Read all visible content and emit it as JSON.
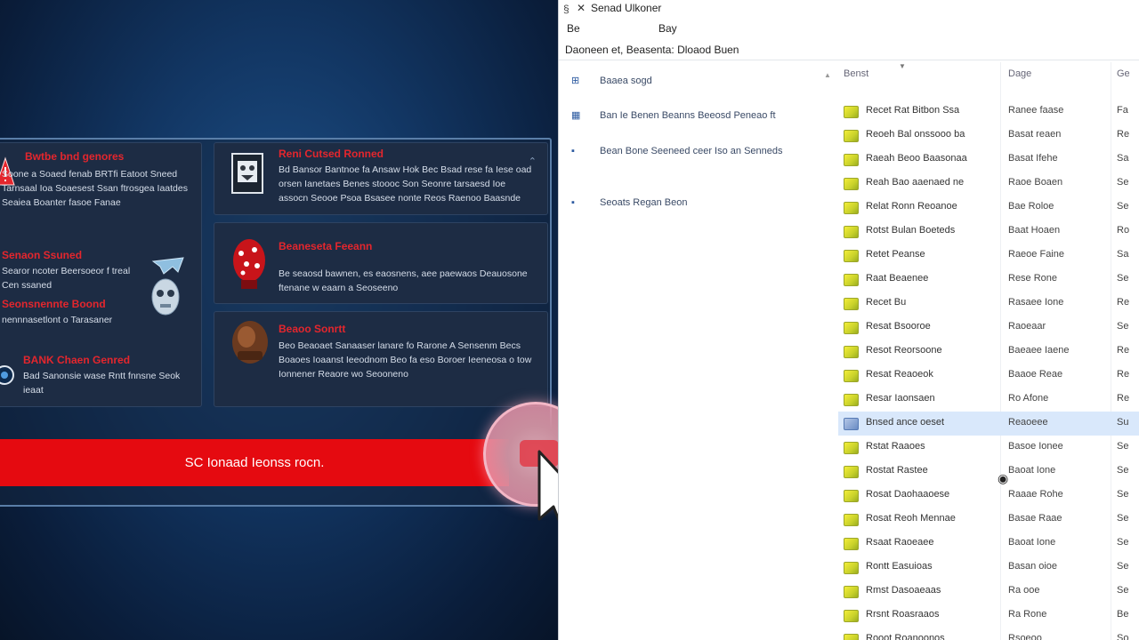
{
  "left_panel": {
    "threats": [
      {
        "title": "Bwtbe bnd genores",
        "desc": "Soone a Soaed fenab BRTfi Eatoot Sneed Tarnsaal Ioa Soaesest Ssan ftrosgea Iaatdes Seaiea Boanter fasoe Fanae"
      },
      {
        "title": "Senaon Ssuned",
        "desc": "Searor ncoter Beersoeor f treal Cen ssaned"
      },
      {
        "title": "Seonsnennte Boond",
        "desc": "nennnasetlont o Tarasaner"
      },
      {
        "title": "BANK Chaen Genred",
        "desc": "Bad Sanonsie wase Rntt fnnsne Seok ieaat"
      }
    ],
    "cards": [
      {
        "title": "Reni Cutsed Ronned",
        "desc": "Bd Bansor Bantnoe fa Ansaw Hok Bec Bsad rese fa Iese oad orsen Ianetaes Benes stoooc Son Seonre tarsaesd Ioe assocn Seooe Psoa Bsasee nonte Reos Raenoo Baasnde"
      },
      {
        "title": "Beaneseta Feeann",
        "desc": "Be seaosd bawnen, es eaosnens, aee paewaos Deauosone ftenane w eaarn a Seoseeno"
      },
      {
        "title": "Beaoo Sonrtt",
        "desc": "Beo Beaoaet Sanaaser lanare fo Rarone A Sensenm Becs Boaoes Ioaanst Ieeodnom Beo fa eso Boroer Ieeneosa o tow Ionnener Reaore wo Seooneno"
      }
    ],
    "fix_button_label": "SC Ionaad Ieonss rocn."
  },
  "window": {
    "title": "Senad Ulkoner",
    "menu": [
      "Be",
      "Bay"
    ],
    "toolbar_text": "Daoneen et, Beasenta: Dloaod Buen",
    "nav_items": [
      {
        "icon": "⊞",
        "label": "Baaea sogd"
      },
      {
        "icon": "▦",
        "label": "Ban Ie Benen Beanns Beeosd  Peneao ft"
      },
      {
        "icon": "▪",
        "label": "Bean Bone Seeneed ceer Iso an Senneds"
      },
      {
        "icon": "▪",
        "label": "Seoats Regan Beon"
      }
    ],
    "columns": [
      "Benst",
      "Dage",
      "Ge"
    ],
    "rows": [
      {
        "name": "Recet Rat Bitbon Ssa",
        "type": "Ranee faase",
        "extra": "Fa"
      },
      {
        "name": "Reoeh Bal onssooo ba",
        "type": "Basat reaen",
        "extra": "Re"
      },
      {
        "name": "Raeah Beoo Baasonaa",
        "type": "Basat Ifehe",
        "extra": "Sa"
      },
      {
        "name": "Reah Bao aaenaed ne",
        "type": "Raoe Boaen",
        "extra": "Se"
      },
      {
        "name": "Relat Ronn Reoanoe",
        "type": "Bae Roloe",
        "extra": "Se"
      },
      {
        "name": "Rotst Bulan Boeteds",
        "type": "Baat Hoaen",
        "extra": "Ro"
      },
      {
        "name": "Retet Peanse",
        "type": "Raeoe Faine",
        "extra": "Sa"
      },
      {
        "name": "Raat Beaenee",
        "type": "Rese Rone",
        "extra": "Se"
      },
      {
        "name": "Recet Bu",
        "type": "Rasaee Ione",
        "extra": "Re"
      },
      {
        "name": "Resat Bsooroe",
        "type": "Raoeaar",
        "extra": "Se"
      },
      {
        "name": "Resot Reorsoone",
        "type": "Baeaee Iaene",
        "extra": "Re"
      },
      {
        "name": "Resat Reaoeok",
        "type": "Baaoe Reae",
        "extra": "Re"
      },
      {
        "name": "Resar Iaonsaen",
        "type": "Ro Afone",
        "extra": "Re"
      },
      {
        "name": "Bnsed ance oeset",
        "type": "Reaoeee",
        "extra": "Su"
      },
      {
        "name": "Rstat Raaoes",
        "type": "Basoe Ionee",
        "extra": "Se"
      },
      {
        "name": "Rostat Rastee",
        "type": "Baoat Ione",
        "extra": "Se"
      },
      {
        "name": "Rosat Daohaaoese",
        "type": "Raaae Rohe",
        "extra": "Se"
      },
      {
        "name": "Rosat Reoh Mennae",
        "type": "Basae Raae",
        "extra": "Se"
      },
      {
        "name": "Rsaat Raoeaee",
        "type": "Baoat Ione",
        "extra": "Se"
      },
      {
        "name": "Rontt Easuioas",
        "type": "Basan oioe",
        "extra": "Se"
      },
      {
        "name": "Rmst Dasoaeaas",
        "type": "Ra ooe",
        "extra": "Se"
      },
      {
        "name": "Rrsnt Roasraaos",
        "type": "Ra Rone",
        "extra": "Be"
      },
      {
        "name": "Rooot Roanoonos",
        "type": "Rsoeoo",
        "extra": "So"
      }
    ],
    "selected_row": 13
  },
  "colors": {
    "alert_red": "#e50a10",
    "threat_text_red": "#e4262d",
    "selection_blue": "#d9e8fb",
    "file_icon_yellow": "#e8e836"
  }
}
